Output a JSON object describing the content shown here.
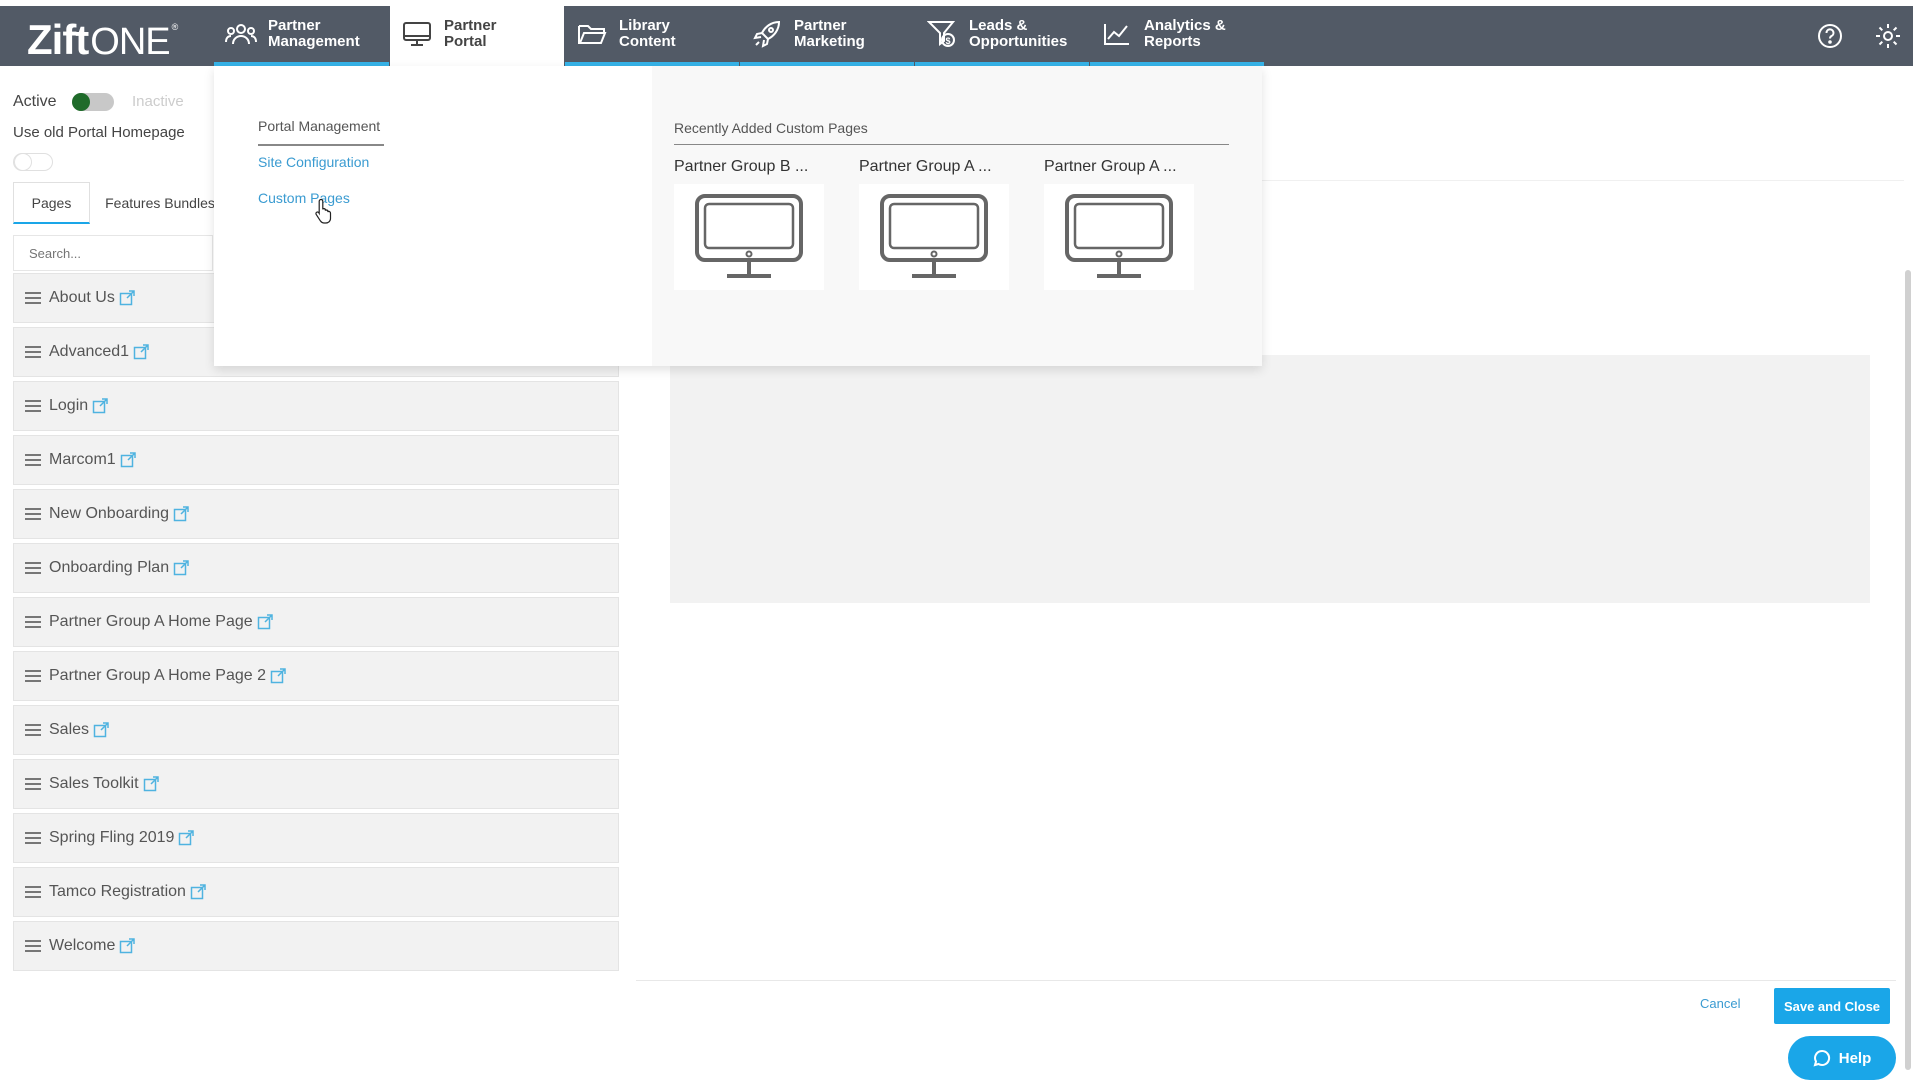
{
  "app": {
    "logo_main": "Zift",
    "logo_secondary": "ONE",
    "logo_tm": "®"
  },
  "nav": {
    "tabs": [
      {
        "label_1": "Partner",
        "label_2": "Management",
        "icon": "people-icon"
      },
      {
        "label_1": "Partner",
        "label_2": "Portal",
        "icon": "monitor-icon"
      },
      {
        "label_1": "Library",
        "label_2": "Content",
        "icon": "folder-icon"
      },
      {
        "label_1": "Partner",
        "label_2": "Marketing",
        "icon": "rocket-icon"
      },
      {
        "label_1": "Leads &",
        "label_2": "Opportunities",
        "icon": "funnel-dollar-icon"
      },
      {
        "label_1": "Analytics &",
        "label_2": "Reports",
        "icon": "chart-icon"
      }
    ]
  },
  "status": {
    "active_label": "Active",
    "inactive_label": "Inactive",
    "old_portal_label": "Use old Portal Homepage"
  },
  "tabs": {
    "pages": "Pages",
    "features_bundles": "Features Bundles"
  },
  "search": {
    "placeholder": "Search..."
  },
  "pages": [
    "About Us",
    "Advanced1",
    "Login",
    "Marcom1",
    "New Onboarding",
    "Onboarding Plan",
    "Partner Group A Home Page",
    "Partner Group A Home Page 2",
    "Sales",
    "Sales Toolkit",
    "Spring Fling 2019",
    "Tamco Registration",
    "Welcome"
  ],
  "dropdown": {
    "heading": "Portal Management",
    "links": [
      "Site Configuration",
      "Custom Pages"
    ],
    "recent_heading": "Recently Added Custom Pages",
    "cards": [
      "Partner Group B ...",
      "Partner Group A ...",
      "Partner Group A ..."
    ]
  },
  "actions": {
    "cancel": "Cancel",
    "save": "Save and Close",
    "help": "Help"
  },
  "colors": {
    "topbar": "#525a66",
    "accent": "#1aa6e8",
    "link": "#3a9bd1",
    "toggle_on": "#1f6b2a"
  }
}
